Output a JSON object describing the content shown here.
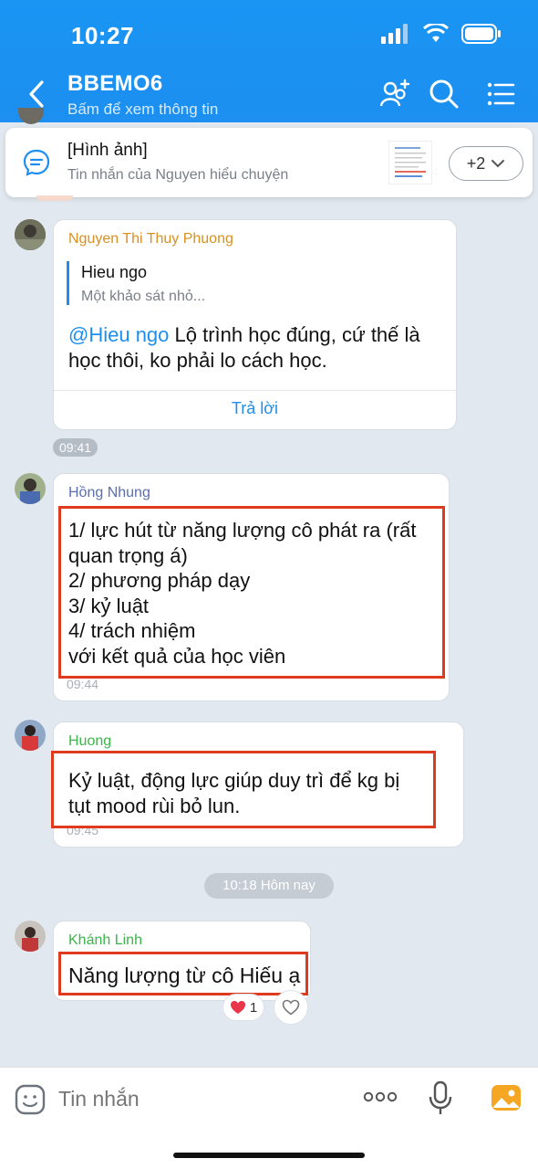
{
  "status": {
    "time": "10:27"
  },
  "header": {
    "title": "BBEMO6",
    "subtitle": "Bấm để xem thông tin"
  },
  "pinned": {
    "title": "[Hình ảnh]",
    "subtitle": "Tin nhắn của Nguyen hiểu chuyện",
    "more_label": "+2"
  },
  "messages": [
    {
      "sender": "Nguyen Thi Thuy Phuong",
      "quote_author": "Hieu ngo",
      "quote_text": "Một khảo sát nhỏ...",
      "mention": "@Hieu ngo",
      "text_line1_rest": " Lộ trình học đúng, cứ thế là",
      "text_line2": "học thôi, ko phải lo cách học.",
      "reply_label": "Trả lời",
      "time": "09:41"
    },
    {
      "sender": "Hồng Nhung",
      "lines": [
        "1/ lực hút từ năng lượng cô phát ra (rất",
        "quan trọng á)",
        "2/ phương pháp dạy",
        "3/ kỷ luật",
        "4/ trách nhiệm",
        "với kết quả của học viên"
      ],
      "time": "09:44"
    },
    {
      "sender": "Huong",
      "lines": [
        "Kỷ luật, động lực giúp duy trì để kg bị",
        "tụt mood rùi bỏ lun."
      ],
      "time": "09:45"
    },
    {
      "sender": "Khánh Linh",
      "text": "Năng lượng từ cô Hiếu ạ",
      "reaction_count": "1"
    }
  ],
  "date_divider": "10:18 Hôm nay",
  "composer": {
    "placeholder": "Tin nhắn"
  },
  "colors": {
    "accent": "#1c8ff0",
    "highlight_box": "#e03a1e"
  }
}
